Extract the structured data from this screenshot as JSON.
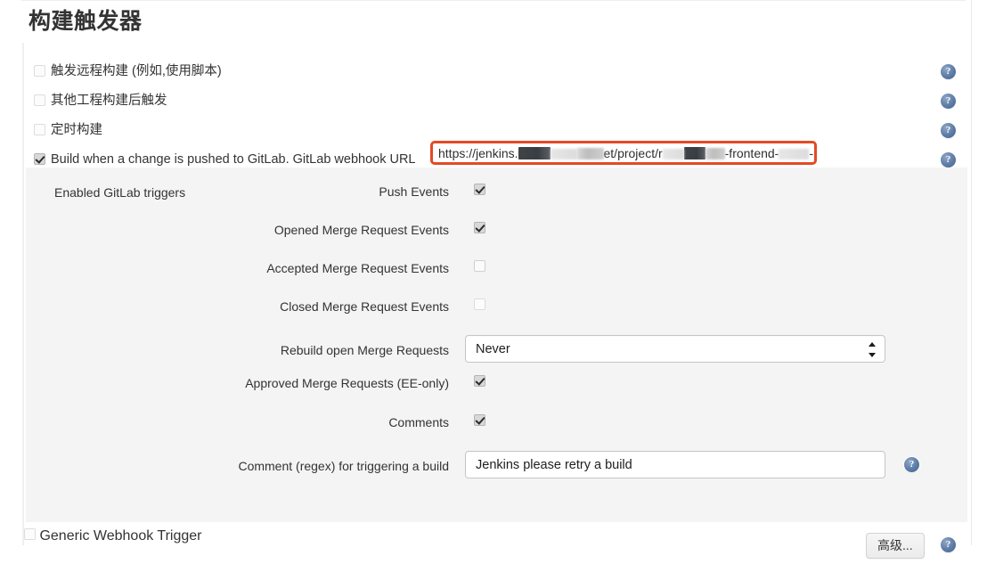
{
  "section": {
    "title": "构建触发器"
  },
  "triggers": [
    {
      "label": "触发远程构建 (例如,使用脚本)",
      "checked": false,
      "help": "?"
    },
    {
      "label": "其他工程构建后触发",
      "checked": false,
      "help": "?"
    },
    {
      "label": "定时构建",
      "checked": false,
      "help": "?"
    },
    {
      "label": "Build when a change is pushed to GitLab. GitLab webhook URL",
      "checked": true,
      "help": "?"
    }
  ],
  "webhook_url": {
    "prefix": "https://jenkins.",
    "middle": "et/project/r",
    "suffix1": "-frontend-",
    "suffix2": "-prod",
    "highlight_color": "#e34a24"
  },
  "gitlab_triggers": {
    "group_label": "Enabled GitLab triggers",
    "rows": [
      {
        "label": "Push Events",
        "type": "checkbox",
        "checked": true
      },
      {
        "label": "Opened Merge Request Events",
        "type": "checkbox",
        "checked": true
      },
      {
        "label": "Accepted Merge Request Events",
        "type": "checkbox",
        "checked": false
      },
      {
        "label": "Closed Merge Request Events",
        "type": "checkbox",
        "checked": false
      },
      {
        "label": "Rebuild open Merge Requests",
        "type": "select",
        "value": "Never"
      },
      {
        "label": "Approved Merge Requests (EE-only)",
        "type": "checkbox",
        "checked": true
      },
      {
        "label": "Comments",
        "type": "checkbox",
        "checked": true
      },
      {
        "label": "Comment (regex) for triggering a build",
        "type": "text",
        "value": "Jenkins please retry a build",
        "help": "?"
      }
    ],
    "advanced_button": "高级..."
  },
  "bottom": {
    "label": "Generic Webhook Trigger",
    "checked": false,
    "help": "?"
  }
}
